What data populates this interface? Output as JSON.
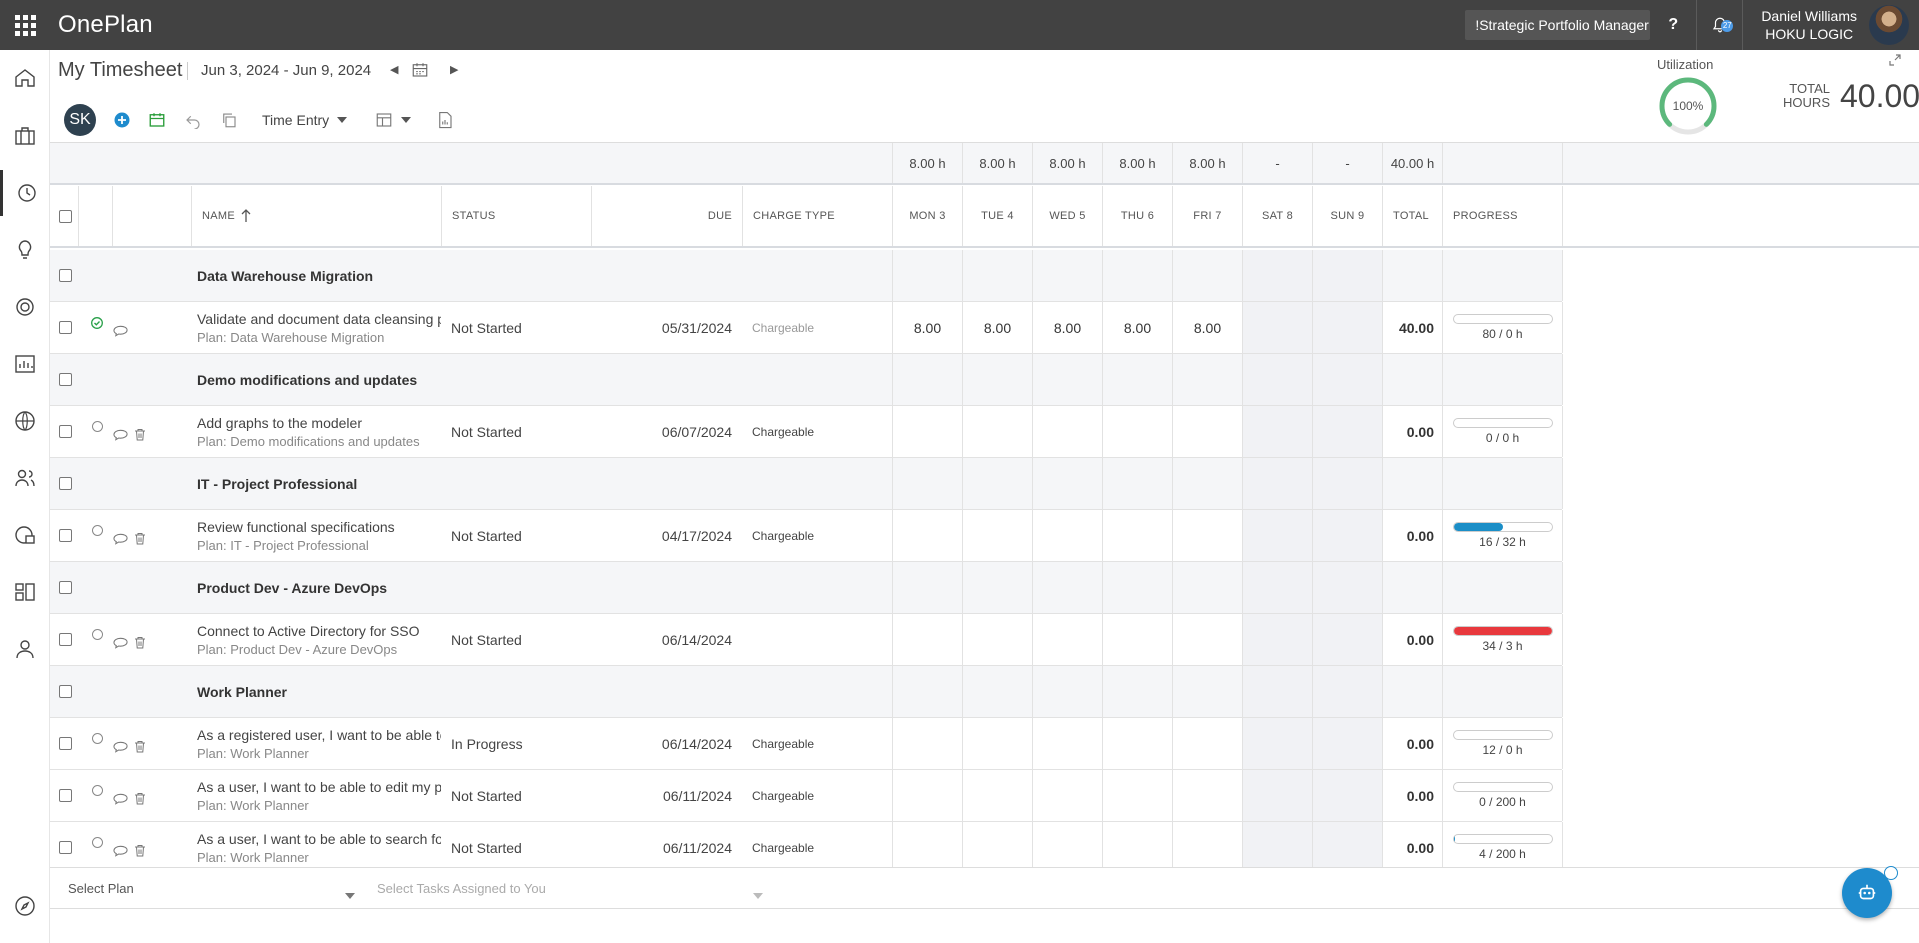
{
  "app": {
    "brand": "OnePlan"
  },
  "topbar": {
    "plan_selector": "!Strategic Portfolio Manager",
    "help_label": "?",
    "notification_count": "27",
    "user_name": "Daniel Williams",
    "user_org": "HOKU LOGIC"
  },
  "sidebar": {
    "items": [
      "home-icon",
      "portfolio-icon",
      "timesheet-icon",
      "ideas-icon",
      "goals-icon",
      "reports-icon",
      "globe-icon",
      "resources-icon",
      "finance-icon",
      "boards-icon",
      "profile-icon",
      "compass-icon"
    ]
  },
  "header": {
    "title": "My Timesheet",
    "date_range": "Jun 3, 2024 - Jun 9, 2024",
    "user_initials": "SK",
    "view_label": "Time Entry",
    "utilization_label": "Utilization",
    "utilization_value": "100%",
    "utilization_fraction": 1.0,
    "total_hours_label_1": "TOTAL",
    "total_hours_label_2": "HOURS",
    "total_hours_value": "40.00"
  },
  "summary": {
    "mon": "8.00 h",
    "tue": "8.00 h",
    "wed": "8.00 h",
    "thu": "8.00 h",
    "fri": "8.00 h",
    "sat": "-",
    "sun": "-",
    "total": "40.00 h"
  },
  "columns": {
    "name": "NAME",
    "status": "STATUS",
    "due": "DUE",
    "charge": "CHARGE TYPE",
    "mon": "MON 3",
    "tue": "TUE 4",
    "wed": "WED 5",
    "thu": "THU 6",
    "fri": "FRI 7",
    "sat": "SAT 8",
    "sun": "SUN 9",
    "total": "TOTAL",
    "progress": "PROGRESS"
  },
  "rows": [
    {
      "kind": "group",
      "name": "Data Warehouse Migration"
    },
    {
      "kind": "task",
      "name": "Validate and document data cleansing p",
      "plan": "Plan: Data Warehouse Migration",
      "status": "Not Started",
      "due": "05/31/2024",
      "charge": "Chargeable",
      "charge_light": true,
      "mon": "8.00",
      "tue": "8.00",
      "wed": "8.00",
      "thu": "8.00",
      "fri": "8.00",
      "total": "40.00",
      "progress_text": "80 / 0 h",
      "progress_fraction": 0,
      "progress_color": "#1b8ec7",
      "done": true,
      "deletable": false
    },
    {
      "kind": "group",
      "name": "Demo modifications and updates"
    },
    {
      "kind": "task",
      "name": "Add graphs to the modeler",
      "plan": "Plan: Demo modifications and updates",
      "status": "Not Started",
      "due": "06/07/2024",
      "charge": "Chargeable",
      "charge_light": false,
      "mon": "",
      "tue": "",
      "wed": "",
      "thu": "",
      "fri": "",
      "total": "0.00",
      "progress_text": "0 / 0 h",
      "progress_fraction": 0,
      "progress_color": "#1b8ec7",
      "done": false,
      "deletable": true
    },
    {
      "kind": "group",
      "name": "IT - Project Professional"
    },
    {
      "kind": "task",
      "name": "Review functional specifications",
      "plan": "Plan: IT - Project Professional",
      "status": "Not Started",
      "due": "04/17/2024",
      "charge": "Chargeable",
      "charge_light": false,
      "mon": "",
      "tue": "",
      "wed": "",
      "thu": "",
      "fri": "",
      "total": "0.00",
      "progress_text": "16 / 32 h",
      "progress_fraction": 0.5,
      "progress_color": "#1b8ec7",
      "done": false,
      "deletable": true
    },
    {
      "kind": "group",
      "name": "Product Dev - Azure DevOps"
    },
    {
      "kind": "task",
      "name": "Connect to Active Directory for SSO",
      "plan": "Plan: Product Dev - Azure DevOps",
      "status": "Not Started",
      "due": "06/14/2024",
      "charge": "",
      "charge_light": false,
      "mon": "",
      "tue": "",
      "wed": "",
      "thu": "",
      "fri": "",
      "total": "0.00",
      "progress_text": "34 / 3 h",
      "progress_fraction": 1.0,
      "progress_color": "#e8383d",
      "done": false,
      "deletable": true
    },
    {
      "kind": "group",
      "name": "Work Planner"
    },
    {
      "kind": "task",
      "name": "As a registered user, I want to be able to",
      "plan": "Plan: Work Planner",
      "status": "In Progress",
      "due": "06/14/2024",
      "charge": "Chargeable",
      "charge_light": false,
      "mon": "",
      "tue": "",
      "wed": "",
      "thu": "",
      "fri": "",
      "total": "0.00",
      "progress_text": "12 / 0 h",
      "progress_fraction": 0,
      "progress_color": "#1b8ec7",
      "done": false,
      "deletable": true
    },
    {
      "kind": "task",
      "name": "As a user, I want to be able to edit my p",
      "plan": "Plan: Work Planner",
      "status": "Not Started",
      "due": "06/11/2024",
      "charge": "Chargeable",
      "charge_light": false,
      "mon": "",
      "tue": "",
      "wed": "",
      "thu": "",
      "fri": "",
      "total": "0.00",
      "progress_text": "0 / 200 h",
      "progress_fraction": 0,
      "progress_color": "#1b8ec7",
      "done": false,
      "deletable": true
    },
    {
      "kind": "task",
      "name": "As a user, I want to be able to search for",
      "plan": "Plan: Work Planner",
      "status": "Not Started",
      "due": "06/11/2024",
      "charge": "Chargeable",
      "charge_light": false,
      "mon": "",
      "tue": "",
      "wed": "",
      "thu": "",
      "fri": "",
      "total": "0.00",
      "progress_text": "4 / 200 h",
      "progress_fraction": 0.02,
      "progress_color": "#1b8ec7",
      "done": false,
      "deletable": true
    }
  ],
  "footer": {
    "select_plan": "Select Plan",
    "select_tasks": "Select Tasks Assigned to You"
  }
}
